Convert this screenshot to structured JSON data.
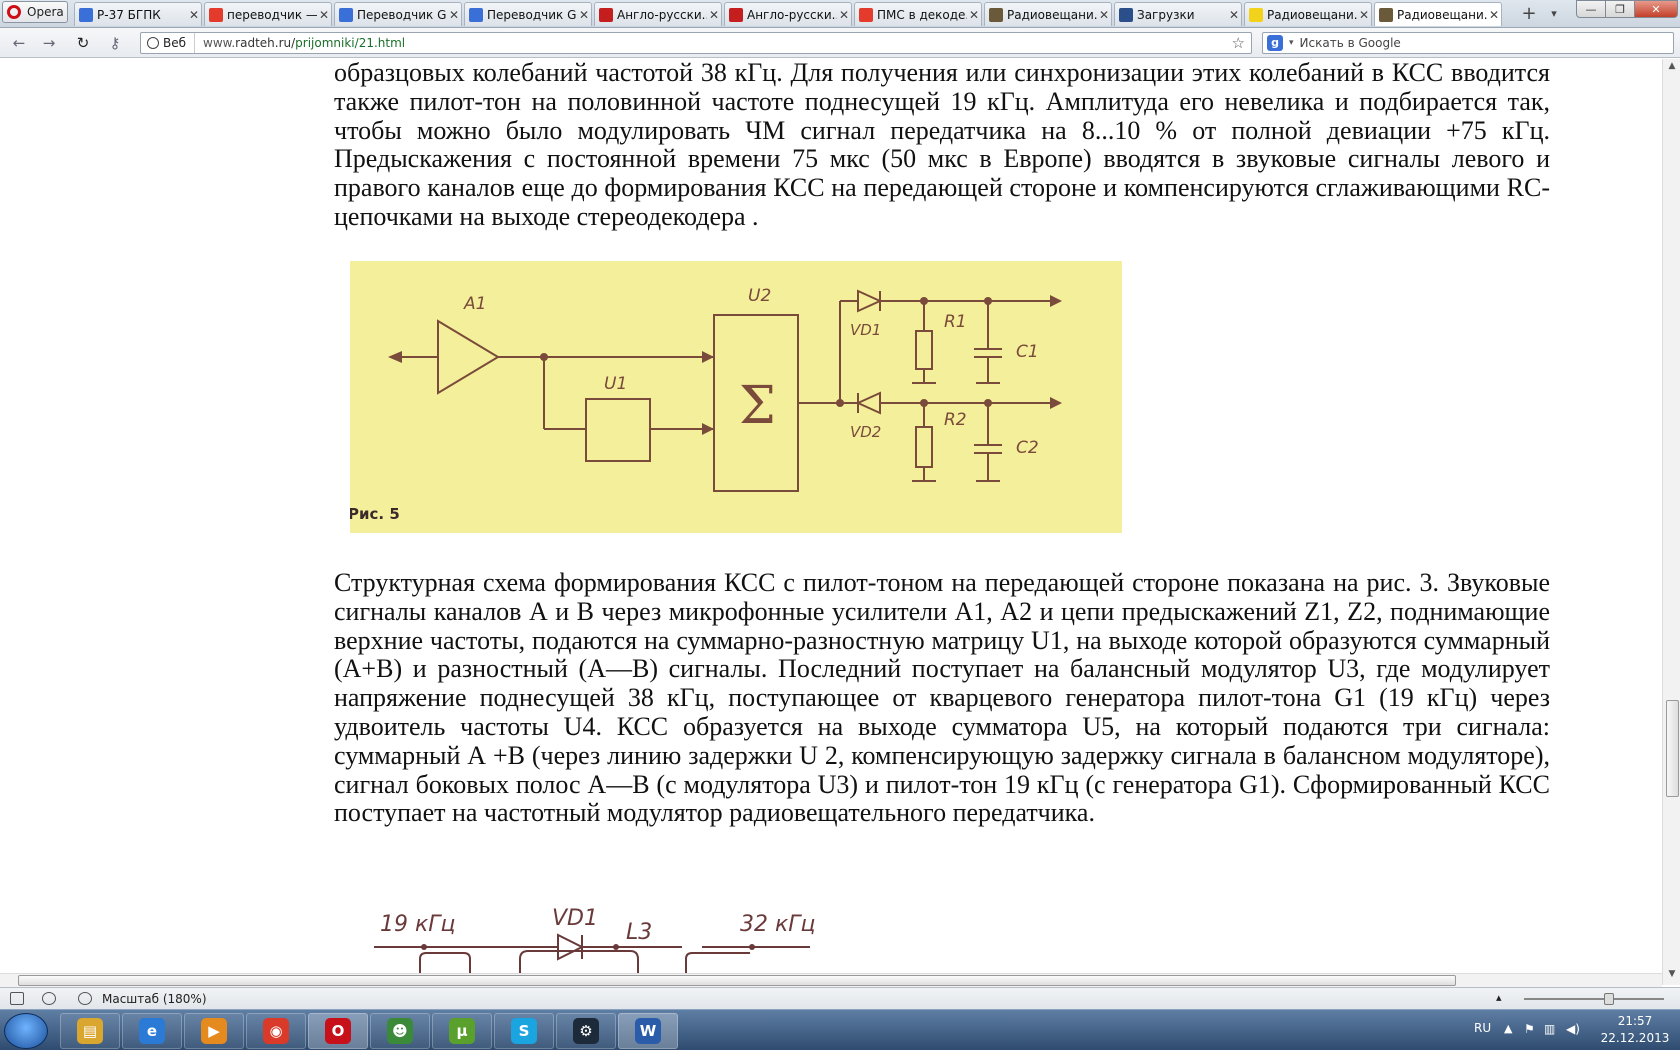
{
  "browser": {
    "app_button": "Opera",
    "tabs": [
      {
        "label": "Р-37 БГПК",
        "fav_color": "#3b6fd8",
        "active": false
      },
      {
        "label": "переводчик —...",
        "fav_color": "#e43b2c",
        "active": false
      },
      {
        "label": "Переводчик G...",
        "fav_color": "#3b6fd8",
        "active": false
      },
      {
        "label": "Переводчик G...",
        "fav_color": "#3b6fd8",
        "active": false
      },
      {
        "label": "Англо-русски...",
        "fav_color": "#c41e1e",
        "active": false
      },
      {
        "label": "Англо-русски...",
        "fav_color": "#c41e1e",
        "active": false
      },
      {
        "label": "ПМС в декоде...",
        "fav_color": "#e43b2c",
        "active": false
      },
      {
        "label": "Радиовещани...",
        "fav_color": "#6b5a3a",
        "active": false
      },
      {
        "label": "Загрузки",
        "fav_color": "#2b4f8a",
        "active": false
      },
      {
        "label": "Радиовещани...",
        "fav_color": "#f2d21a",
        "active": false
      },
      {
        "label": "Радиовещани...",
        "fav_color": "#6b5a3a",
        "active": true
      }
    ],
    "address": {
      "web_badge": "Веб",
      "url_prefix": "www.",
      "url_host": "radteh.ru/",
      "url_path": "prijomniki/21.html"
    },
    "search_placeholder": "Искать в Google",
    "status": {
      "zoom_text": "Масштаб (180%)"
    }
  },
  "page": {
    "para1": "образцовых колебаний частотой 38 кГц. Для получения или синхронизации этих колебаний в КСС вводится также пилот-тон на половинной частоте поднесущей 19 кГц. Амплитуда его невелика и подбирается так, чтобы можно было модулировать ЧМ сигнал передатчика на 8...10 % от полной девиации +75 кГц. Предыскажения с постоянной времени 75 мкс (50 мкс в Европе) вводятся в звуковые сигналы левого и правого каналов еще до формирования КСС на передающей стороне и компенсируются сглаживающими RC-цепочками на выходе стереодекодера .",
    "para2": "Структурная схема формирования КСС с пилот-тоном на передающей стороне показана на рис. 3. Звуковые сигналы каналов А и В через микрофонные усилители А1, А2 и цепи предыскажений Z1, Z2, поднимающие верхние частоты, подаются на суммарно-разностную матрицу U1, на выходе которой образуются суммарный (А+В) и разностный (А—В) сигналы. Последний поступает на балансный модулятор U3, где модулирует напряжение поднесущей 38 кГц, поступающее от кварцевого генератора пилот-тона G1 (19 кГц) через удвоитель частоты U4. КСС образуется на выходе сумматора U5, на который подаются три сигнала: суммарный А +В (через линию задержки U 2, компенсирующую задержку сигнала в балансном модуляторе), сигнал боковых полос А—В (с модулятора U3) и пилот-тон 19 кГц (с генератора G1). Сформированный КСС поступает на частотный модулятор радиовещательного передатчика.",
    "figure5": {
      "caption": "Рис. 5",
      "labels": {
        "a1": "A1",
        "u1": "U1",
        "u2": "U2",
        "sigma": "Σ",
        "vd1": "VD1",
        "vd2": "VD2",
        "r1": "R1",
        "r2": "R2",
        "c1": "C1",
        "c2": "C2"
      }
    },
    "figure_partial": {
      "labels": {
        "f19": "19 кГц",
        "vd1": "VD1",
        "l3": "L3",
        "f32": "32 кГц"
      }
    }
  },
  "taskbar": {
    "apps": [
      {
        "name": "explorer",
        "glyph": "▤",
        "color": "#d9a630"
      },
      {
        "name": "internet-explorer",
        "glyph": "e",
        "color": "#2a7ad6"
      },
      {
        "name": "media-player",
        "glyph": "▶",
        "color": "#e58a1f"
      },
      {
        "name": "chrome",
        "glyph": "◉",
        "color": "#d93a2a"
      },
      {
        "name": "opera",
        "glyph": "O",
        "color": "#c8101a"
      },
      {
        "name": "app-green",
        "glyph": "☻",
        "color": "#3a8a3a"
      },
      {
        "name": "utorrent",
        "glyph": "µ",
        "color": "#5aa02c"
      },
      {
        "name": "skype",
        "glyph": "S",
        "color": "#1aa5e0"
      },
      {
        "name": "steam",
        "glyph": "⚙",
        "color": "#1c2a3a"
      },
      {
        "name": "word",
        "glyph": "W",
        "color": "#2a5caa"
      }
    ],
    "tray": {
      "lang": "RU",
      "time": "21:57",
      "date": "22.12.2013"
    }
  }
}
